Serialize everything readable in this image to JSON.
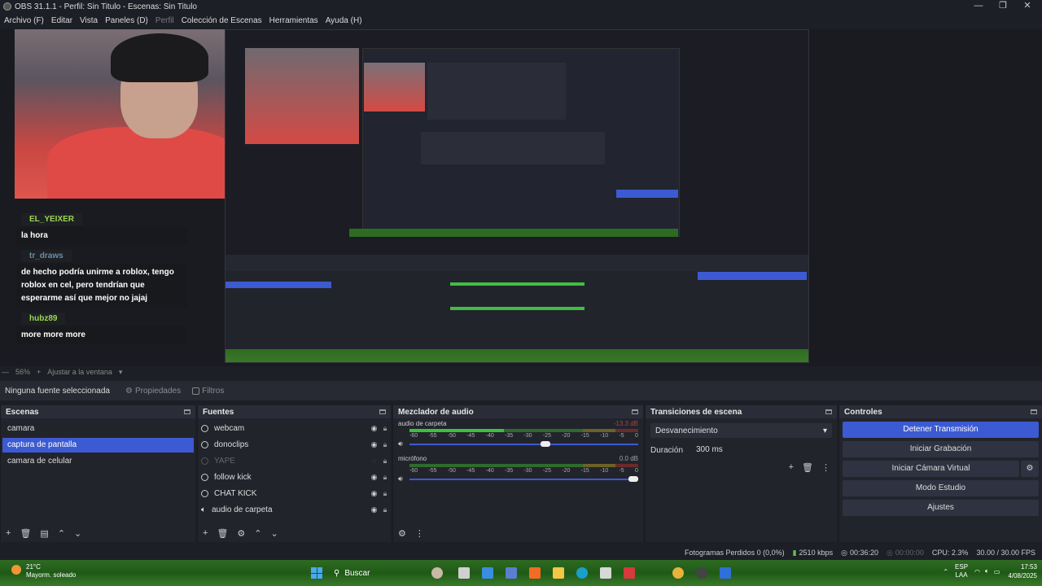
{
  "window": {
    "title": "OBS 31.1.1 - Perfil: Sin Titulo - Escenas: Sin Titulo",
    "controls": [
      "—",
      "❐",
      "✕"
    ]
  },
  "menu": [
    "Archivo (F)",
    "Editar",
    "Vista",
    "Paneles (D)",
    "Perfil",
    "Colección de Escenas",
    "Herramientas",
    "Ayuda (H)"
  ],
  "chat": [
    {
      "user": "EL_YEIXER",
      "message": "la hora"
    },
    {
      "user": "tr_draws",
      "message": "de hecho podría unirme a roblox, tengo roblox en cel, pero tendrían que esperarme así que mejor no jajaj"
    },
    {
      "user": "hubz89",
      "message": "more more more"
    }
  ],
  "zoom": {
    "level": "56%",
    "fit": "Ajustar a la ventana"
  },
  "properties_bar": {
    "no_source": "Ninguna fuente seleccionada",
    "properties_label": "Propiedades",
    "filters_label": "Filtros"
  },
  "scenes": {
    "title": "Escenas",
    "items": [
      "camara",
      "captura de pantalla",
      "camara de celular"
    ],
    "selected": "captura de pantalla"
  },
  "sources": {
    "title": "Fuentes",
    "items": [
      {
        "label": "webcam",
        "visible": true
      },
      {
        "label": "donoclips",
        "visible": true
      },
      {
        "label": "YAPE",
        "visible": false
      },
      {
        "label": "follow kick",
        "visible": true
      },
      {
        "label": "CHAT KICK",
        "visible": true
      },
      {
        "label": "audio de carpeta",
        "visible": true
      }
    ]
  },
  "mixer": {
    "title": "Mezclador de audio",
    "channels": [
      {
        "name": "audio de carpeta",
        "db": "-13.3 dB",
        "level": 0.58,
        "fader": 0.6
      },
      {
        "name": "micrófono",
        "db": "0.0 dB",
        "level": 0.0,
        "fader": 1.0
      }
    ],
    "ticks": [
      "-60",
      "-55",
      "-50",
      "-45",
      "-40",
      "-35",
      "-30",
      "-25",
      "-20",
      "-15",
      "-10",
      "-5",
      "0"
    ]
  },
  "transitions": {
    "title": "Transiciones de escena",
    "selected": "Desvanecimiento",
    "duration_label": "Duración",
    "duration_value": "300 ms"
  },
  "controls": {
    "title": "Controles",
    "buttons": [
      "Detener Transmisión",
      "Iniciar Grabación",
      "Iniciar Cámara Virtual",
      "Modo Estudio",
      "Ajustes"
    ]
  },
  "status": {
    "dropped": "Fotogramas Perdidos 0 (0,0%)",
    "bitrate": "2510 kbps",
    "stream_time": "00:36:20",
    "rec_time": "00:00:00",
    "cpu": "CPU: 2.3%",
    "fps": "30.00 / 30.00 FPS"
  },
  "taskbar": {
    "temperature": "21°C",
    "weather": "Mayorm. soleado",
    "search": "Buscar",
    "lang_top": "ESP",
    "lang_bottom": "LAA",
    "time": "17:53",
    "date": "4/08/2025"
  }
}
